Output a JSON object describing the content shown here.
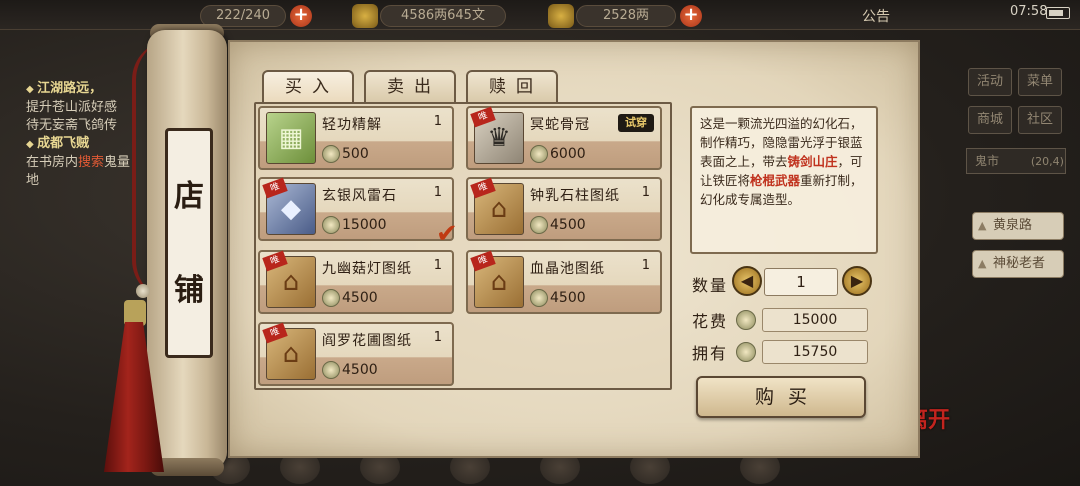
{
  "top_bar": {
    "stamina": "222/240",
    "silver": "4586两645文",
    "gold": "2528两",
    "notice": "公告",
    "time": "07:58"
  },
  "quests": [
    {
      "title": "江湖路远，",
      "lines": [
        "提升苍山派好感",
        "待无妄斋飞鸽传"
      ]
    },
    {
      "title": "成都飞贼",
      "lines": [
        "在书房内",
        "搜索",
        "鬼量",
        "地"
      ]
    }
  ],
  "right_menu": {
    "buttons": [
      "活动",
      "菜单",
      "商城",
      "社区"
    ],
    "map_name": "鬼市",
    "map_coord": "(20,4)",
    "npcs": [
      "黄泉路",
      "神秘老者"
    ]
  },
  "shop": {
    "title_chars": [
      "店",
      "铺"
    ],
    "tabs": [
      "买入",
      "卖出",
      "赎回"
    ],
    "items": [
      {
        "name": "轻功精解",
        "qty": "1",
        "price": "500",
        "icon": "jade-mahjong-icon"
      },
      {
        "name": "冥蛇骨冠",
        "qty": "",
        "price": "6000",
        "icon": "bone-crown-icon",
        "rare": "唯",
        "badge": "试穿"
      },
      {
        "name": "玄银风雷石",
        "qty": "1",
        "price": "15000",
        "icon": "crystal-stone-icon",
        "rare": "唯",
        "selected": true
      },
      {
        "name": "钟乳石柱图纸",
        "qty": "1",
        "price": "4500",
        "icon": "blueprint-book-icon",
        "rare": "唯"
      },
      {
        "name": "九幽菇灯图纸",
        "qty": "1",
        "price": "4500",
        "icon": "blueprint-book-icon",
        "rare": "唯"
      },
      {
        "name": "血晶池图纸",
        "qty": "1",
        "price": "4500",
        "icon": "blueprint-book-icon",
        "rare": "唯"
      },
      {
        "name": "阎罗花圃图纸",
        "qty": "1",
        "price": "4500",
        "icon": "blueprint-book-icon",
        "rare": "唯"
      }
    ],
    "description": {
      "part1": "这是一颗流光四溢的幻化石，制作精巧，隐隐雷光浮于银蓝表面之上，带去",
      "highlight1": "铸剑山庄",
      "part2": "，可让铁匠将",
      "highlight2": "枪棍武器",
      "part3": "重新打制，幻化成专属造型。"
    },
    "quantity_label": "数量",
    "quantity_value": "1",
    "cost_label": "花费",
    "cost_value": "15000",
    "owned_label": "拥有",
    "owned_value": "15750",
    "buy_label": "购买",
    "leave_label": "离开"
  },
  "colors": {
    "accent_red": "#c0321e",
    "parchment": "#e3d6bb"
  }
}
